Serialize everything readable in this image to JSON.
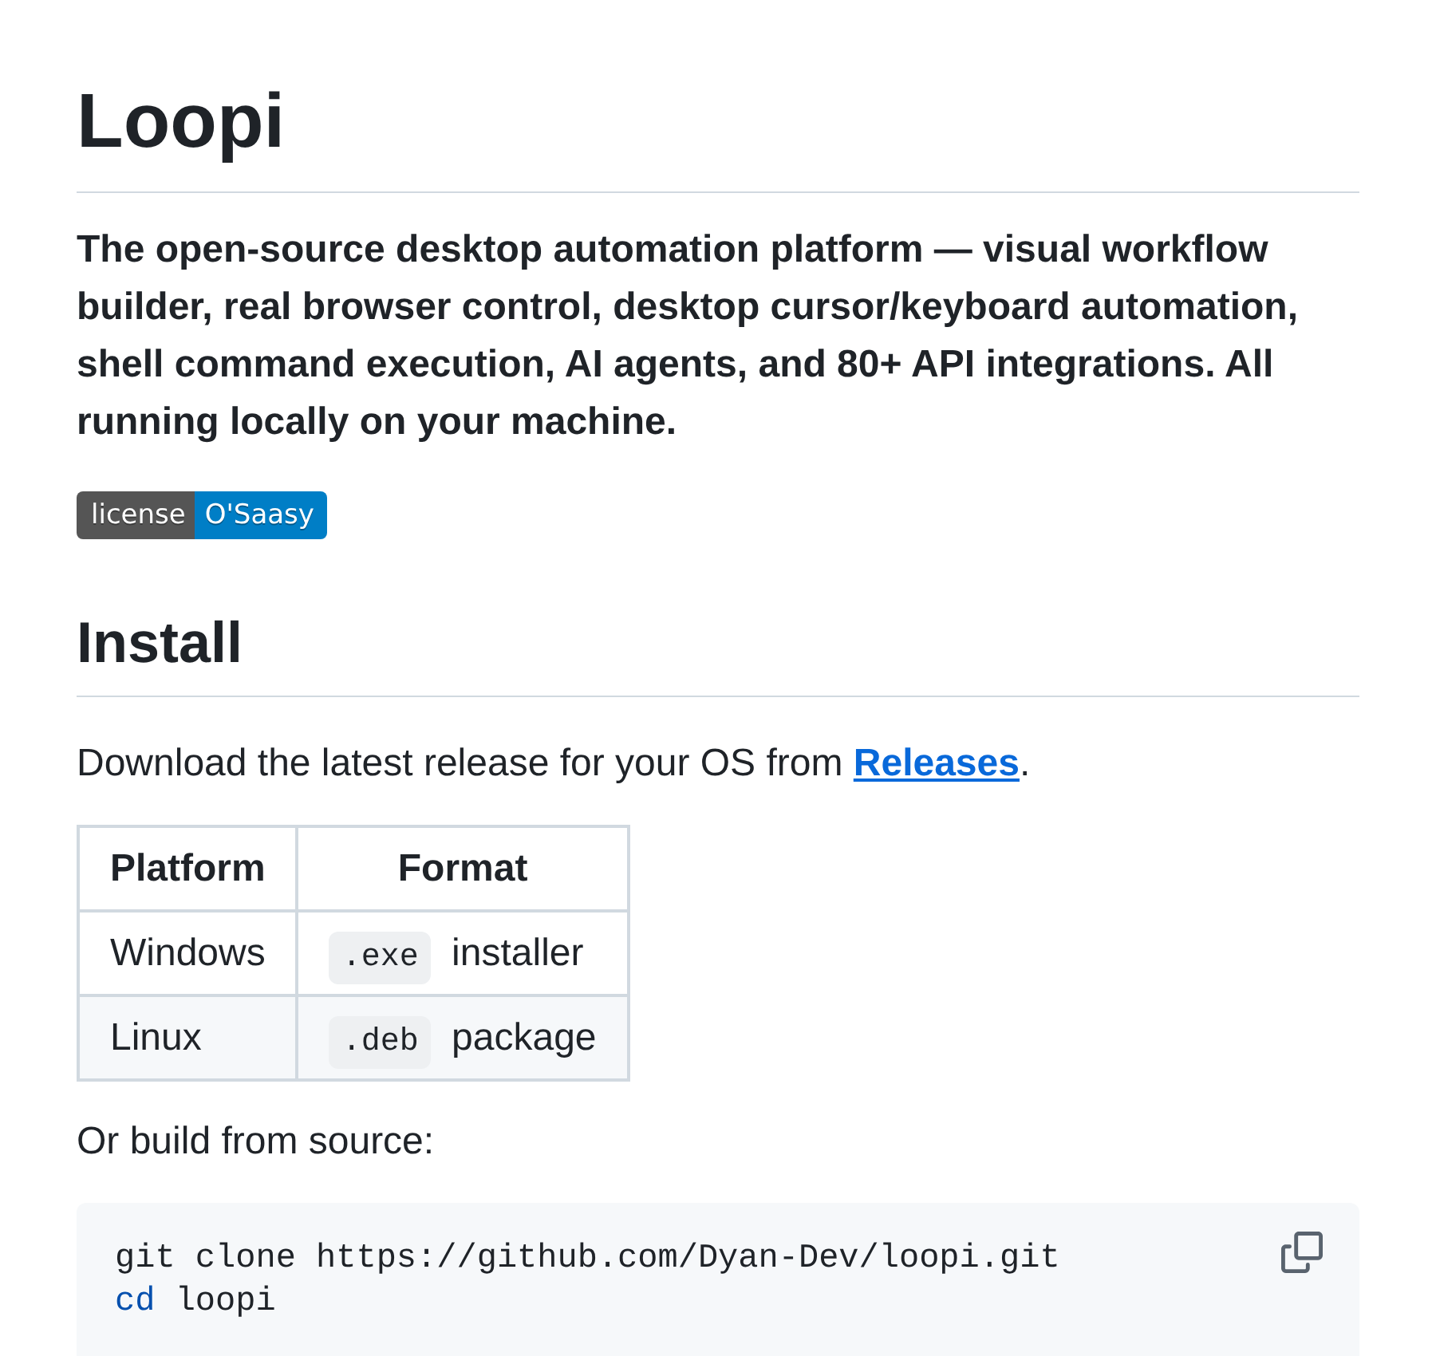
{
  "title": "Loopi",
  "description": "The open-source desktop automation platform — visual workflow builder, real browser control, desktop cursor/keyboard automation, shell command execution, AI agents, and 80+ API integrations. All running locally on your machine.",
  "badge": {
    "label": "license",
    "message": "O'Saasy"
  },
  "install": {
    "heading": "Install",
    "intro_before": "Download the latest release for your OS from ",
    "link": "Releases",
    "intro_after": "."
  },
  "table": {
    "columns": [
      "Platform",
      "Format"
    ],
    "rows": [
      {
        "platform": "Windows",
        "extension": ".exe",
        "format": "installer"
      },
      {
        "platform": "Linux",
        "extension": ".deb",
        "format": "package"
      }
    ]
  },
  "build_text": "Or build from source:",
  "code": {
    "lines": [
      [
        {
          "kind": "plain",
          "text": "git clone https://github.com/Dyan-Dev/loopi.git"
        }
      ],
      [
        {
          "kind": "keyword",
          "text": "cd"
        },
        {
          "kind": "plain",
          "text": " loopi"
        }
      ]
    ]
  }
}
